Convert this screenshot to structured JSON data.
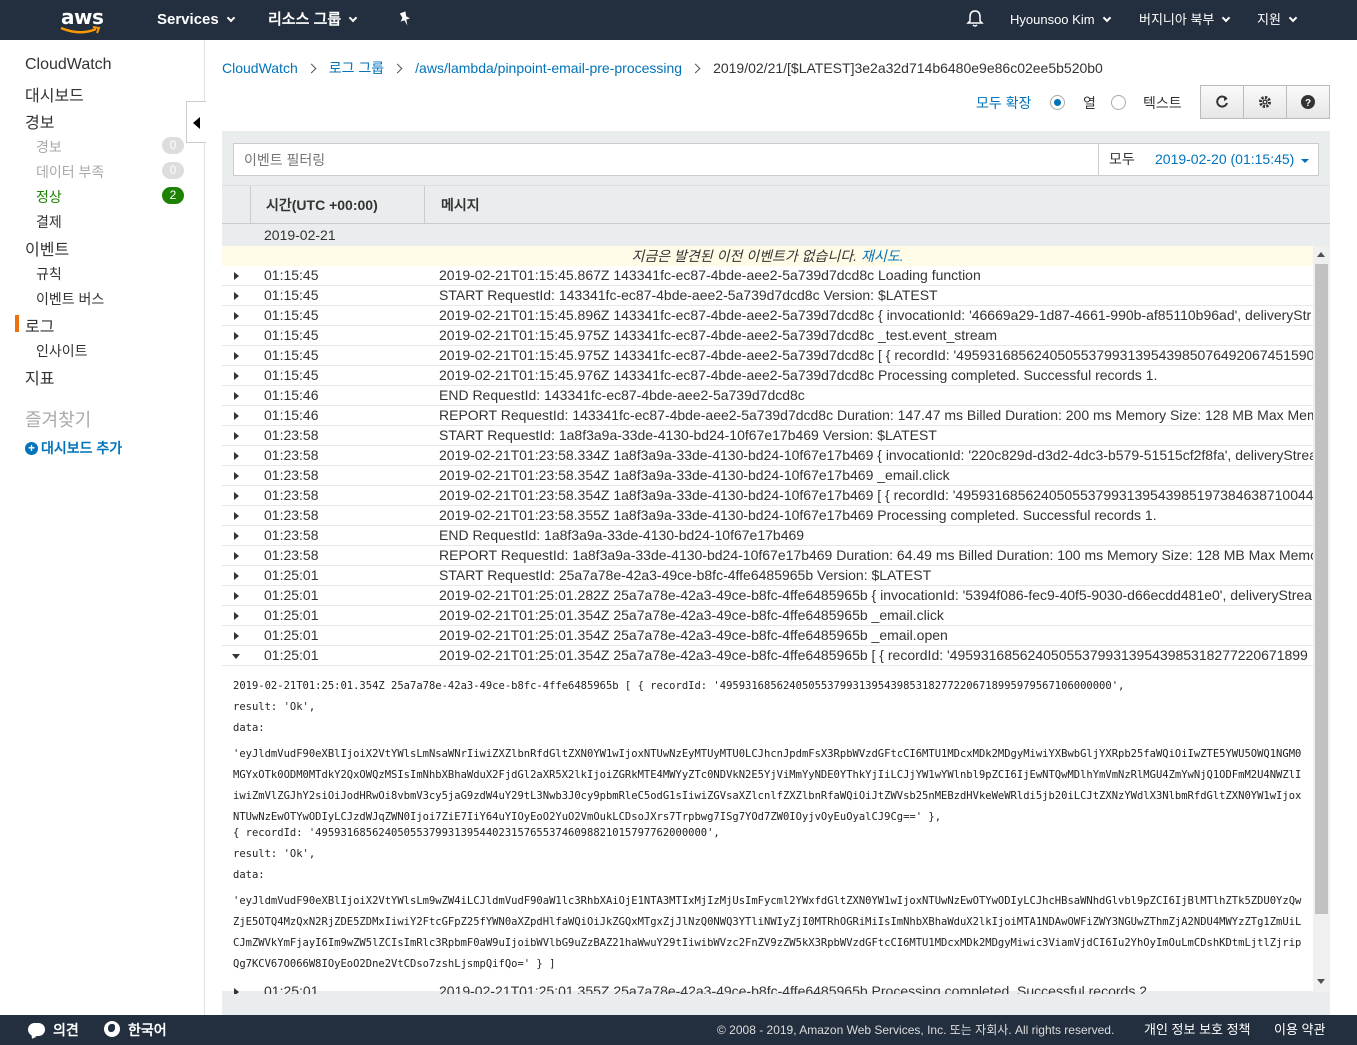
{
  "topnav": {
    "logo": "aws",
    "services": "Services",
    "resource_groups": "리소스 그룹",
    "pin_icon": "pin-icon",
    "bell_icon": "bell-icon",
    "user": "Hyounsoo Kim",
    "region": "버지니아 북부",
    "support": "지원"
  },
  "sidebar": {
    "cloudwatch": "CloudWatch",
    "dashboards": "대시보드",
    "alarms": "경보",
    "alarm_items": [
      {
        "label": "경보",
        "count": "0"
      },
      {
        "label": "데이터 부족",
        "count": "0"
      },
      {
        "label": "정상",
        "count": "2"
      },
      {
        "label": "결제",
        "count": ""
      }
    ],
    "events": "이벤트",
    "rules": "규칙",
    "event_buses": "이벤트 버스",
    "logs": "로그",
    "insights": "인사이트",
    "metrics": "지표",
    "favorites": "즐겨찾기",
    "add_dashboard": "대시보드 추가"
  },
  "breadcrumb": {
    "root": "CloudWatch",
    "log_groups": "로그 그룹",
    "group": "/aws/lambda/pinpoint-email-pre-processing",
    "stream": "2019/02/21/[$LATEST]3e2a32d714b6480e9e86c02ee5b520b0"
  },
  "view": {
    "expand_all": "모두 확장",
    "row_option": "열",
    "text_option": "텍스트",
    "selected": "row"
  },
  "filter": {
    "placeholder": "이벤트 필터링",
    "range_label": "모두",
    "range_value": "2019-02-20 (01:15:45)"
  },
  "table": {
    "col_time": "시간(UTC +00:00)",
    "col_message": "메시지",
    "date_group": "2019-02-21",
    "notice_text": "지금은 발견된 이전 이벤트가 없습니다. ",
    "notice_link": "재시도.",
    "rows": [
      {
        "time": "01:15:45",
        "msg": "2019-02-21T01:15:45.867Z 143341fc-ec87-4bde-aee2-5a739d7dcd8c Loading function"
      },
      {
        "time": "01:15:45",
        "msg": "START RequestId: 143341fc-ec87-4bde-aee2-5a739d7dcd8c Version: $LATEST"
      },
      {
        "time": "01:15:45",
        "msg": "2019-02-21T01:15:45.896Z 143341fc-ec87-4bde-aee2-5a739d7dcd8c { invocationId: '46669a29-1d87-4661-990b-af85110b96ad', deliveryStr"
      },
      {
        "time": "01:15:45",
        "msg": "2019-02-21T01:15:45.975Z 143341fc-ec87-4bde-aee2-5a739d7dcd8c _test.event_stream"
      },
      {
        "time": "01:15:45",
        "msg": "2019-02-21T01:15:45.975Z 143341fc-ec87-4bde-aee2-5a739d7dcd8c [ { recordId: '4959316856240505537993139543985076492067451590"
      },
      {
        "time": "01:15:45",
        "msg": "2019-02-21T01:15:45.976Z 143341fc-ec87-4bde-aee2-5a739d7dcd8c Processing completed. Successful records 1."
      },
      {
        "time": "01:15:46",
        "msg": "END RequestId: 143341fc-ec87-4bde-aee2-5a739d7dcd8c"
      },
      {
        "time": "01:15:46",
        "msg": "REPORT RequestId: 143341fc-ec87-4bde-aee2-5a739d7dcd8c Duration: 147.47 ms Billed Duration: 200 ms Memory Size: 128 MB Max Mem"
      },
      {
        "time": "01:23:58",
        "msg": "START RequestId: 1a8f3a9a-33de-4130-bd24-10f67e17b469 Version: $LATEST"
      },
      {
        "time": "01:23:58",
        "msg": "2019-02-21T01:23:58.334Z 1a8f3a9a-33de-4130-bd24-10f67e17b469 { invocationId: '220c829d-d3d2-4dc3-b579-51515cf2f8fa', deliveryStrea"
      },
      {
        "time": "01:23:58",
        "msg": "2019-02-21T01:23:58.354Z 1a8f3a9a-33de-4130-bd24-10f67e17b469 _email.click"
      },
      {
        "time": "01:23:58",
        "msg": "2019-02-21T01:23:58.354Z 1a8f3a9a-33de-4130-bd24-10f67e17b469 [ { recordId: '49593168562405055379931395439851973846387100448"
      },
      {
        "time": "01:23:58",
        "msg": "2019-02-21T01:23:58.355Z 1a8f3a9a-33de-4130-bd24-10f67e17b469 Processing completed. Successful records 1."
      },
      {
        "time": "01:23:58",
        "msg": "END RequestId: 1a8f3a9a-33de-4130-bd24-10f67e17b469"
      },
      {
        "time": "01:23:58",
        "msg": "REPORT RequestId: 1a8f3a9a-33de-4130-bd24-10f67e17b469 Duration: 64.49 ms Billed Duration: 100 ms Memory Size: 128 MB Max Memo"
      },
      {
        "time": "01:25:01",
        "msg": "START RequestId: 25a7a78e-42a3-49ce-b8fc-4ffe6485965b Version: $LATEST"
      },
      {
        "time": "01:25:01",
        "msg": "2019-02-21T01:25:01.282Z 25a7a78e-42a3-49ce-b8fc-4ffe6485965b { invocationId: '5394f086-fec9-40f5-9030-d66ecdd481e0', deliveryStrea"
      },
      {
        "time": "01:25:01",
        "msg": "2019-02-21T01:25:01.354Z 25a7a78e-42a3-49ce-b8fc-4ffe6485965b _email.click"
      },
      {
        "time": "01:25:01",
        "msg": "2019-02-21T01:25:01.354Z 25a7a78e-42a3-49ce-b8fc-4ffe6485965b _email.open"
      },
      {
        "time": "01:25:01",
        "msg": "2019-02-21T01:25:01.354Z 25a7a78e-42a3-49ce-b8fc-4ffe6485965b [ { recordId: '4959316856240505537993139543985318277220671899"
      }
    ],
    "expanded_lines": [
      "2019-02-21T01:25:01.354Z 25a7a78e-42a3-49ce-b8fc-4ffe6485965b [ { recordId: '49593168562405055379931395439853182772206718995979567106000000',",
      "result: 'Ok',",
      "data:",
      "'eyJldmVudF90eXBlIjoiX2VtYWlsLmNsaWNrIiwiZXZlbnRfdGltZXN0YW1wIjoxNTUwNzEyMTUyMTU0LCJhcnJpdmFsX3RpbWVzdGFtcCI6MTU1MDcxMDk2MDgyMiwiYXBwbGljYXRpb25faWQiOiIwZTE5YWU5OWQ1NGM0MGYxOTk0ODM0MTdkY2QxOWQzMSIsImNhbXBhaWduX2FjdGl2aXR5X2lkIjoiZGRkMTE4MWYyZTc0NDVkN2E5YjViMmYyNDE0YThkYjIiLCJjYW1wYWlnbl9pZCI6IjEwNTQwMDlhYmVmNzRlMGU4ZmYwNjQ1ODFmM2U4NWZlIiwiZmVlZGJhY2siOiJodHRwOi8vbmV3cy5jaG9zdW4uY29tL3Nwb3J0cy9pbmRleC5odG1sIiwiZGVsaXZlcnlfZXZlbnRfaWQiOiJtZWVsb25nMEBzdHVkeWeWRldi5jb20iLCJtZXNzYWdlX3NlbmRfdGltZXN0YW1wIjoxNTUwNzEwOTYwODIyLCJzdWJqZWN0Ijoi7ZiE7IiY64uYIOyEoO2YuO2VmOukLCDsoJXrs7Trpbwg7ISg7YOd7ZW0IOyjvOyEuOyalCJ9Cg==' },",
      "{ recordId: '49593168562405055379931395440231576553746098821015797762000000',",
      "result: 'Ok',",
      "data:",
      "'eyJldmVudF90eXBlIjoiX2VtYWlsLm9wZW4iLCJldmVudF90aW1lc3RhbXAiOjE1NTA3MTIxMjIzMjUsImFycml2YWxfdGltZXN0YW1wIjoxNTUwNzEwOTYwODIyLCJhcHBsaWNhdGlvbl9pZCI6IjBlMTlhZTk5ZDU0YzQwZjE5OTQ4MzQxN2RjZDE5ZDMxIiwiY2FtcGFpZ25fYWN0aXZpdHlfaWQiOiJkZGQxMTgxZjJlNzQ0NWQ3YTliNWIyZjI0MTRhOGRiMiIsImNhbXBhaWduX2lkIjoiMTA1NDAwOWFiZWY3NGUwZThmZjA2NDU4MWYzZTg1ZmUiLCJmZWVkYmFjayI6Im9wZW5lZCIsImRlc3RpbmF0aW9uIjoibWVlbG9uZzBAZ21haWwuY29tIiwibWVzc2FnZV9zZW5kX3RpbWVzdGFtcCI6MTU1MDcxMDk2MDgyMiwic3ViamVjdCI6Iu2YhOyImOuLmCDshKDtmLjtlZjripQg7KCV67O066W8IOyEoO2Dne2VtCDso7zshLjsmpQifQo=' } ]"
    ],
    "last_row": {
      "time": "01:25:01",
      "msg": "2019-02-21T01:25:01.355Z 25a7a78e-42a3-49ce-b8fc-4ffe6485965b Processing completed. Successful records 2"
    }
  },
  "footer": {
    "feedback": "의견",
    "language": "한국어",
    "copyright": "© 2008 - 2019, Amazon Web Services, Inc. 또는 자회사. All rights reserved.",
    "privacy": "개인 정보 보호 정책",
    "terms": "이용 약관"
  },
  "colors": {
    "nav_bg": "#232f3e",
    "link": "#0073bb",
    "active_accent": "#ec7211",
    "ok_green": "#1d8102"
  }
}
